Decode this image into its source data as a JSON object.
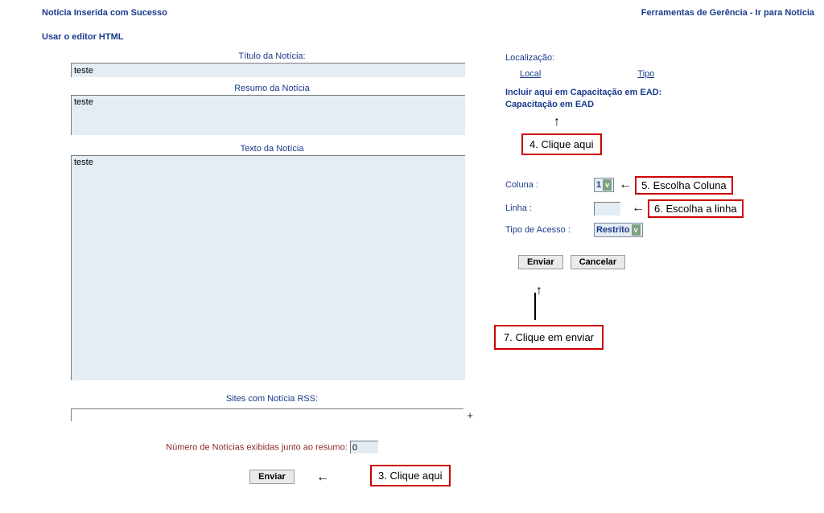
{
  "header": {
    "status": "Notícia Inserida com Sucesso",
    "tools_label": "Ferramentas de Gerência",
    "separator": " - ",
    "go_to_news": "Ir para Notícia",
    "use_editor": "Usar o editor HTML"
  },
  "form": {
    "title_label": "Título da Notícia:",
    "title_value": "teste",
    "summary_label": "Resumo da Notícia",
    "summary_value": "teste",
    "body_label": "Texto da Notícia",
    "body_value": "teste",
    "rss_label": "Sites com Notícia RSS:",
    "rss_value": "",
    "plus": "+",
    "num_label": "Número de Notícias exibidas junto ao resumo:",
    "num_value": "0",
    "send_button": "Enviar"
  },
  "right": {
    "localization_label": "Localização:",
    "local_header": "Local",
    "tipo_header": "Tipo",
    "include_line1": "Incluir aqui em Capacitação em EAD:",
    "include_line2": "Capacitação em EAD",
    "coluna_label": "Coluna :",
    "coluna_value": "1",
    "linha_label": "Linha :",
    "linha_value": "",
    "acesso_label": "Tipo de Acesso :",
    "acesso_value": "Restrito",
    "enviar": "Enviar",
    "cancelar": "Cancelar"
  },
  "callouts": {
    "c3": "3. Clique aqui",
    "c4": "4. Clique aqui",
    "c5": "5. Escolha Coluna",
    "c6": "6. Escolha a linha",
    "c7": "7.  Clique em enviar"
  }
}
